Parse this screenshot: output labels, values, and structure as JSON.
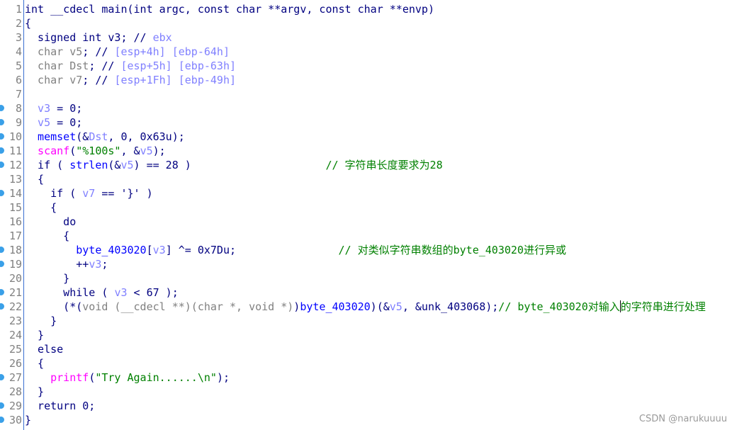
{
  "colors": {
    "keyword": "#000080",
    "type_gray": "#808080",
    "variable": "#8080ff",
    "function": "#0000ff",
    "import": "#ff00ff",
    "string": "#008000",
    "comment": "#008000",
    "breakpoint_dot": "#3aa0e8"
  },
  "watermark": "CSDN @narukuuuu",
  "lines": [
    {
      "n": "1",
      "dot": false,
      "t": [
        [
          "k",
          "int __cdecl main(int argc, const char **argv, const char **envp)"
        ]
      ]
    },
    {
      "n": "2",
      "dot": false,
      "t": [
        [
          "k",
          "{"
        ]
      ]
    },
    {
      "n": "3",
      "dot": false,
      "t": [
        [
          "k",
          "  signed int v3; // "
        ],
        [
          "v",
          "ebx"
        ]
      ]
    },
    {
      "n": "4",
      "dot": false,
      "t": [
        [
          "g",
          "  char v5"
        ],
        [
          "k",
          "; // "
        ],
        [
          "v",
          "[esp+4h] [ebp-64h]"
        ]
      ]
    },
    {
      "n": "5",
      "dot": false,
      "t": [
        [
          "g",
          "  char Dst"
        ],
        [
          "k",
          "; // "
        ],
        [
          "v",
          "[esp+5h] [ebp-63h]"
        ]
      ]
    },
    {
      "n": "6",
      "dot": false,
      "t": [
        [
          "g",
          "  char v7"
        ],
        [
          "k",
          "; // "
        ],
        [
          "v",
          "[esp+1Fh] [ebp-49h]"
        ]
      ]
    },
    {
      "n": "7",
      "dot": false,
      "t": []
    },
    {
      "n": "8",
      "dot": true,
      "t": [
        [
          "v",
          "  v3"
        ],
        [
          "k",
          " = 0;"
        ]
      ]
    },
    {
      "n": "9",
      "dot": true,
      "t": [
        [
          "v",
          "  v5"
        ],
        [
          "k",
          " = 0;"
        ]
      ]
    },
    {
      "n": "10",
      "dot": true,
      "t": [
        [
          "f",
          "  memset"
        ],
        [
          "k",
          "(&"
        ],
        [
          "v",
          "Dst"
        ],
        [
          "k",
          ", 0, 0x63u);"
        ]
      ]
    },
    {
      "n": "11",
      "dot": true,
      "t": [
        [
          "m",
          "  scanf"
        ],
        [
          "k",
          "("
        ],
        [
          "s",
          "\"%100s\""
        ],
        [
          "k",
          ", &"
        ],
        [
          "v",
          "v5"
        ],
        [
          "k",
          ");"
        ]
      ]
    },
    {
      "n": "12",
      "dot": true,
      "t": [
        [
          "k",
          "  if ( "
        ],
        [
          "f",
          "strlen"
        ],
        [
          "k",
          "(&"
        ],
        [
          "v",
          "v5"
        ],
        [
          "k",
          ") == 28 )                     "
        ],
        [
          "c",
          "// 字符串长度要求为28"
        ]
      ]
    },
    {
      "n": "13",
      "dot": false,
      "t": [
        [
          "k",
          "  {"
        ]
      ]
    },
    {
      "n": "14",
      "dot": true,
      "t": [
        [
          "k",
          "    if ( "
        ],
        [
          "v",
          "v7"
        ],
        [
          "k",
          " == '}' )"
        ]
      ]
    },
    {
      "n": "15",
      "dot": false,
      "t": [
        [
          "k",
          "    {"
        ]
      ]
    },
    {
      "n": "16",
      "dot": false,
      "t": [
        [
          "k",
          "      do"
        ]
      ]
    },
    {
      "n": "17",
      "dot": false,
      "t": [
        [
          "k",
          "      {"
        ]
      ]
    },
    {
      "n": "18",
      "dot": true,
      "t": [
        [
          "f",
          "        byte_403020"
        ],
        [
          "k",
          "["
        ],
        [
          "v",
          "v3"
        ],
        [
          "k",
          "] ^= 0x7Du;                "
        ],
        [
          "c",
          "// 对类似字符串数组的byte_403020进行异或"
        ]
      ]
    },
    {
      "n": "19",
      "dot": true,
      "t": [
        [
          "k",
          "        ++"
        ],
        [
          "v",
          "v3"
        ],
        [
          "k",
          ";"
        ]
      ]
    },
    {
      "n": "20",
      "dot": false,
      "t": [
        [
          "k",
          "      }"
        ]
      ]
    },
    {
      "n": "21",
      "dot": true,
      "t": [
        [
          "k",
          "      while ( "
        ],
        [
          "v",
          "v3"
        ],
        [
          "k",
          " < 67 );"
        ]
      ]
    },
    {
      "n": "22",
      "dot": true,
      "t": [
        [
          "k",
          "      (*("
        ],
        [
          "g",
          "void (__cdecl **)(char *, void *)"
        ],
        [
          "k",
          ")"
        ],
        [
          "f",
          "byte_403020"
        ],
        [
          "k",
          ")(&"
        ],
        [
          "v",
          "v5"
        ],
        [
          "k",
          ", &unk_403068);"
        ],
        [
          "c",
          "// byte_403020对输入"
        ],
        [
          "cursor",
          ""
        ],
        [
          "c",
          "的字符串进行处理"
        ]
      ]
    },
    {
      "n": "23",
      "dot": false,
      "t": [
        [
          "k",
          "    }"
        ]
      ]
    },
    {
      "n": "24",
      "dot": false,
      "t": [
        [
          "k",
          "  }"
        ]
      ]
    },
    {
      "n": "25",
      "dot": false,
      "t": [
        [
          "k",
          "  else"
        ]
      ]
    },
    {
      "n": "26",
      "dot": false,
      "t": [
        [
          "k",
          "  {"
        ]
      ]
    },
    {
      "n": "27",
      "dot": true,
      "t": [
        [
          "m",
          "    printf"
        ],
        [
          "k",
          "("
        ],
        [
          "s",
          "\"Try Again......\\n\""
        ],
        [
          "k",
          ");"
        ]
      ]
    },
    {
      "n": "28",
      "dot": false,
      "t": [
        [
          "k",
          "  }"
        ]
      ]
    },
    {
      "n": "29",
      "dot": true,
      "t": [
        [
          "k",
          "  return 0;"
        ]
      ]
    },
    {
      "n": "30",
      "dot": true,
      "t": [
        [
          "k",
          "}"
        ]
      ]
    }
  ]
}
